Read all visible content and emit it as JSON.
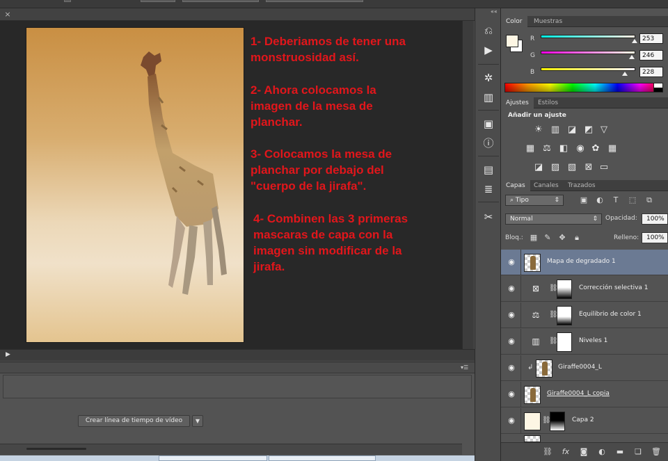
{
  "document": {
    "close_glyph": "×",
    "notes": [
      "1- Deberiamos de tener una\nmonstruosidad así.",
      "2- Ahora colocamos la\nimagen de la mesa de\nplanchar.",
      "3- Colocamos la mesa de\nplanchar por debajo del\n\"cuerpo de la jirafa\".",
      "4- Combinen las 3 primeras\nmascaras de capa con la\nimagen sin modificar de la\njirafa."
    ],
    "note_color": "#e2161b"
  },
  "timeline": {
    "create_button": "Crear línea de tiempo de vídeo",
    "dropdown_glyph": "▼"
  },
  "color_panel": {
    "tabs": [
      "Color",
      "Muestras"
    ],
    "channels": [
      {
        "label": "R",
        "value": "253",
        "fraction": 0.99
      },
      {
        "label": "G",
        "value": "246",
        "fraction": 0.96
      },
      {
        "label": "B",
        "value": "228",
        "fraction": 0.89
      }
    ],
    "foreground": "#fdf6e4",
    "background": "#ffffff"
  },
  "adjustments_panel": {
    "tabs": [
      "Ajustes",
      "Estilos"
    ],
    "heading": "Añadir un ajuste"
  },
  "layers_panel": {
    "tabs": [
      "Capas",
      "Canales",
      "Trazados"
    ],
    "filter_kind": "Tipo",
    "blend_mode": "Normal",
    "opacity_label": "Opacidad:",
    "opacity_value": "100%",
    "lock_label": "Bloq.:",
    "fill_label": "Relleno:",
    "fill_value": "100%",
    "layers": [
      {
        "name": "Mapa de degradado 1",
        "selected": true
      },
      {
        "name": "Corrección selectiva 1"
      },
      {
        "name": "Equilibrio de color 1"
      },
      {
        "name": "Niveles 1"
      },
      {
        "name": "Giraffe0004_L"
      },
      {
        "name": "Giraffe0004_L copia"
      },
      {
        "name": "Capa 2"
      }
    ]
  }
}
